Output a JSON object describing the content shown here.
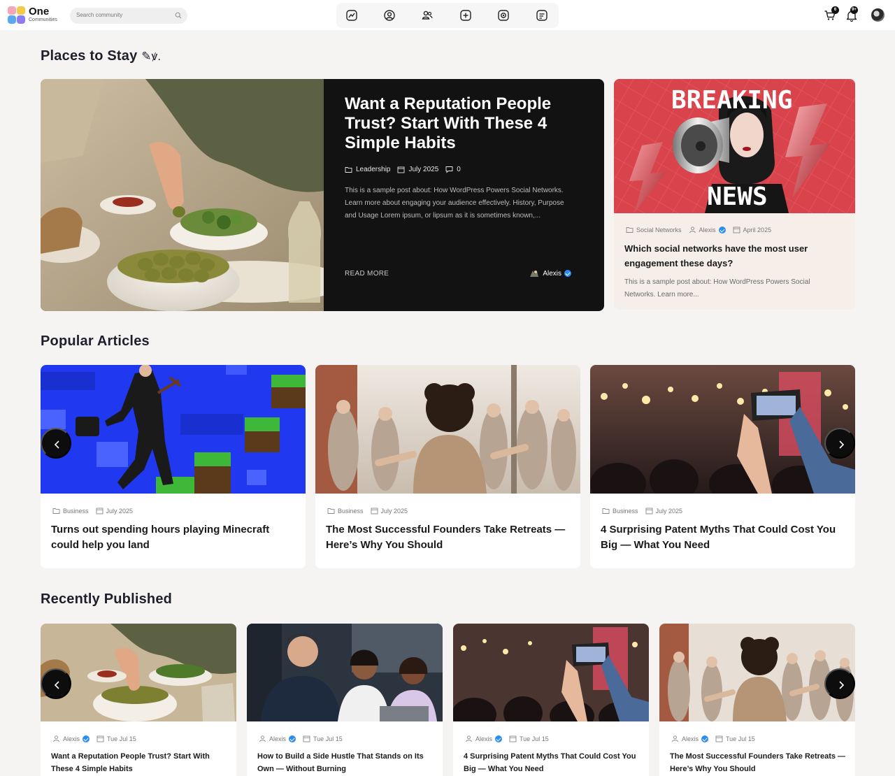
{
  "header": {
    "brand_name": "One",
    "brand_sub": "Communities",
    "search_placeholder": "Search community",
    "nav_icons": [
      "activity-icon",
      "profile-icon",
      "members-icon",
      "add-post-icon",
      "camera-icon",
      "notes-icon"
    ],
    "cart_count": "6",
    "notification_count": "9+"
  },
  "sections": {
    "places": "Places to Stay",
    "places_emoji": "✎ꝟ.",
    "popular": "Popular Articles",
    "recent": "Recently Published"
  },
  "hero": {
    "title": "Want a Reputation People Trust? Start With These 4 Simple Habits",
    "category": "Leadership",
    "date": "July 2025",
    "comments": "0",
    "excerpt": "This is a sample post about: How WordPress Powers Social Networks. Learn more about engaging your audience effectively. History, Purpose and Usage Lorem ipsum, or lipsum as it is sometimes known,...",
    "read_more": "READ MORE",
    "author": "Alexis"
  },
  "side": {
    "image_text_top": "BREAKING",
    "image_text_bottom": "NEWS",
    "category": "Social Networks",
    "author": "Alexis",
    "date": "April 2025",
    "title": "Which social networks have the most user engagement these days?",
    "excerpt": "This is a sample post about: How WordPress Powers Social Networks. Learn more..."
  },
  "popular": [
    {
      "category": "Business",
      "date": "July 2025",
      "title": "Turns out spending hours playing Minecraft could help you land"
    },
    {
      "category": "Business",
      "date": "July 2025",
      "title": "The Most Successful Founders Take Retreats — Here’s Why You Should"
    },
    {
      "category": "Business",
      "date": "July 2025",
      "title": "4 Surprising Patent Myths That Could Cost You Big — What You Need"
    }
  ],
  "recent": [
    {
      "author": "Alexis",
      "date": "Tue Jul 15",
      "title": "Want a Reputation People Trust? Start With These 4 Simple Habits"
    },
    {
      "author": "Alexis",
      "date": "Tue Jul 15",
      "title": "How to Build a Side Hustle That Stands on Its Own — Without Burning"
    },
    {
      "author": "Alexis",
      "date": "Tue Jul 15",
      "title": "4 Surprising Patent Myths That Could Cost You Big — What You Need"
    },
    {
      "author": "Alexis",
      "date": "Tue Jul 15",
      "title": "The Most Successful Founders Take Retreats — Here’s Why You Should"
    }
  ],
  "colors": {
    "accent": "#2d8cf0",
    "hero_bg": "#121212",
    "side_card_bg": "#f6efe9",
    "breaking_red": "#d9434b"
  }
}
